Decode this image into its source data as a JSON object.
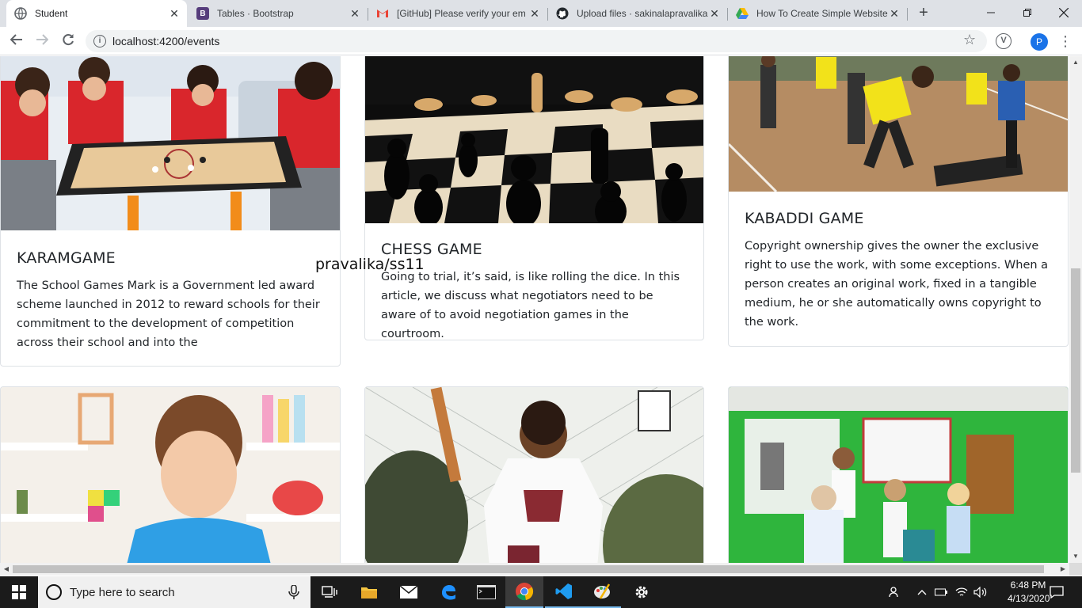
{
  "browser": {
    "tabs": [
      {
        "title": "Student",
        "favicon": "chrome-globe-icon",
        "active": true
      },
      {
        "title": "Tables · Bootstrap",
        "favicon": "bootstrap-icon",
        "favicon_color": "#563d7c",
        "active": false
      },
      {
        "title": "[GitHub] Please verify your em",
        "favicon": "gmail-icon",
        "favicon_color": "#ea4335",
        "active": false
      },
      {
        "title": "Upload files · sakinalapravalika",
        "favicon": "github-icon",
        "favicon_color": "#24292e",
        "active": false
      },
      {
        "title": "How To Create Simple Website",
        "favicon": "google-drive-icon",
        "favicon_color": "#fbbc04",
        "active": false
      }
    ],
    "url": "localhost:4200/events",
    "profile_initial": "P",
    "extension_initial": "V"
  },
  "page": {
    "overlay_text": "pravalika/ss11",
    "cards": [
      {
        "title": "KARAMGAME",
        "text": "The School Games Mark is a Government led award scheme launched in 2012 to reward schools for their commitment to the development of competition across their school and into the",
        "image": "children-playing-carrom-image"
      },
      {
        "title": "CHESS GAME",
        "text": "Going to trial, it’s said, is like rolling the dice. In this article, we discuss what negotiators need to be aware of to avoid negotiation games in the courtroom.",
        "image": "chess-board-image"
      },
      {
        "title": "KABADDI GAME",
        "text": "Copyright ownership gives the owner the exclusive right to use the work, with some exceptions. When a person creates an original work, fixed in a tangible medium, he or she automatically owns copyright to the work.",
        "image": "kabaddi-match-image"
      },
      {
        "title": "",
        "text": "",
        "image": "boy-playing-image"
      },
      {
        "title": "",
        "text": "",
        "image": "boy-cricket-image"
      },
      {
        "title": "",
        "text": "",
        "image": "kids-classroom-image"
      }
    ]
  },
  "taskbar": {
    "search_placeholder": "Type here to search",
    "time": "6:48 PM",
    "date": "4/13/2020",
    "accent": "#76b9ed"
  }
}
